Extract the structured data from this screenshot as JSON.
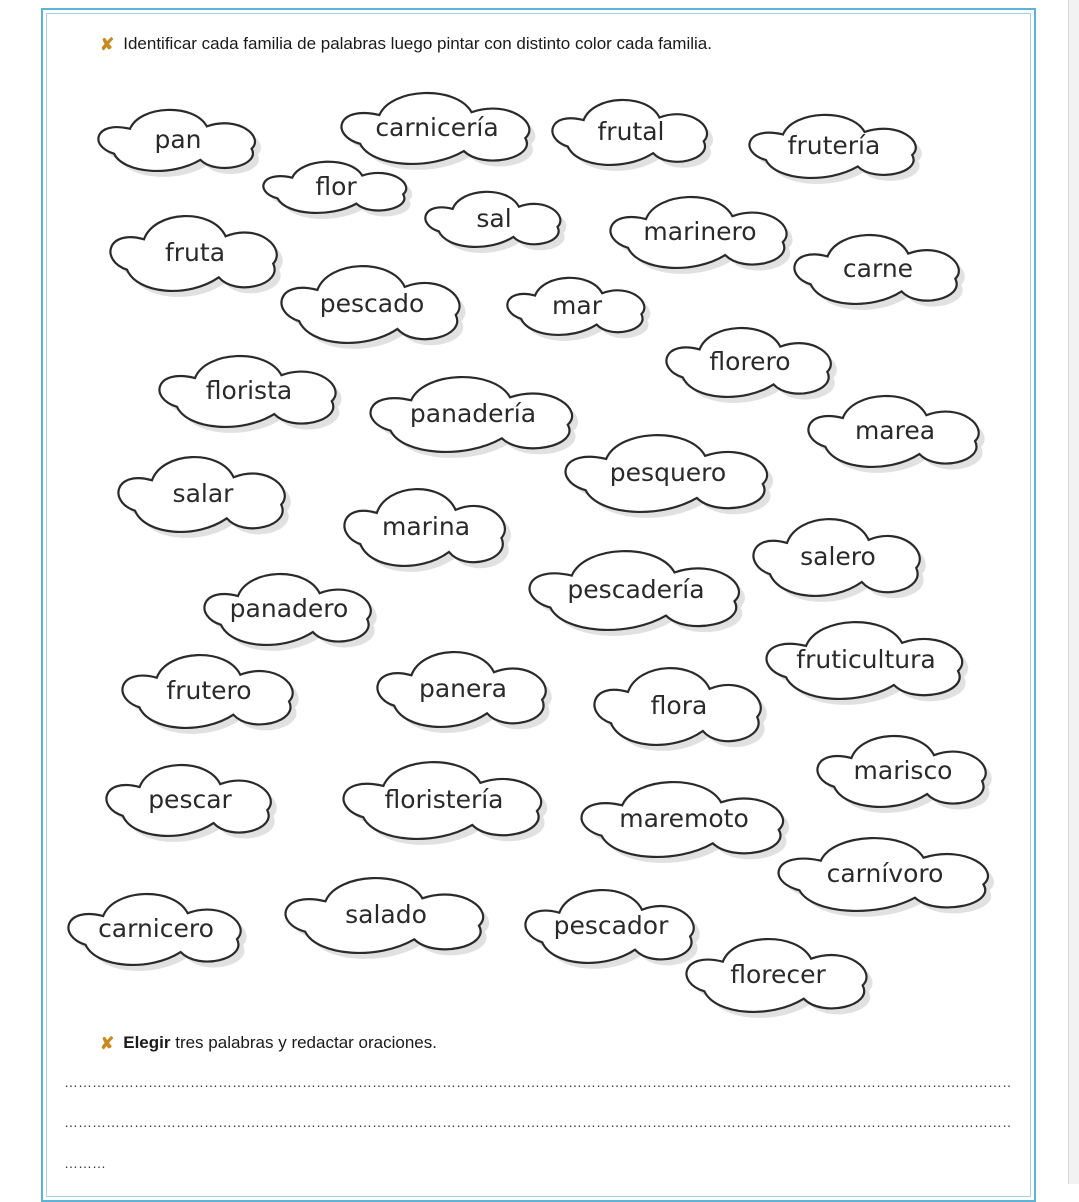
{
  "instructions": {
    "first": "Identificar cada familia de palabras luego pintar con distinto color cada familia.",
    "second_bold": "Elegir",
    "second_rest": " tres palabras y redactar oraciones."
  },
  "bullet_glyph": "✘",
  "bullet_color": "#c68a1f",
  "frame_color": "#5fb4d6",
  "words": [
    "pan",
    "carnicería",
    "frutal",
    "frutería",
    "flor",
    "sal",
    "marinero",
    "fruta",
    "carne",
    "pescado",
    "mar",
    "florero",
    "florista",
    "panadería",
    "marea",
    "pesquero",
    "salar",
    "marina",
    "salero",
    "pescadería",
    "panadero",
    "fruticultura",
    "frutero",
    "panera",
    "flora",
    "marisco",
    "pescar",
    "floristería",
    "maremoto",
    "carnívoro",
    "carnicero",
    "salado",
    "pescador",
    "florecer"
  ],
  "answer_lines": {
    "line1": "………………………………………………………………………………………………………………………………………………………………………………………………………………………………",
    "line2": "………………………………………………………………………………………………………………………………………………………………………………………………………………………………",
    "line3": "………"
  }
}
